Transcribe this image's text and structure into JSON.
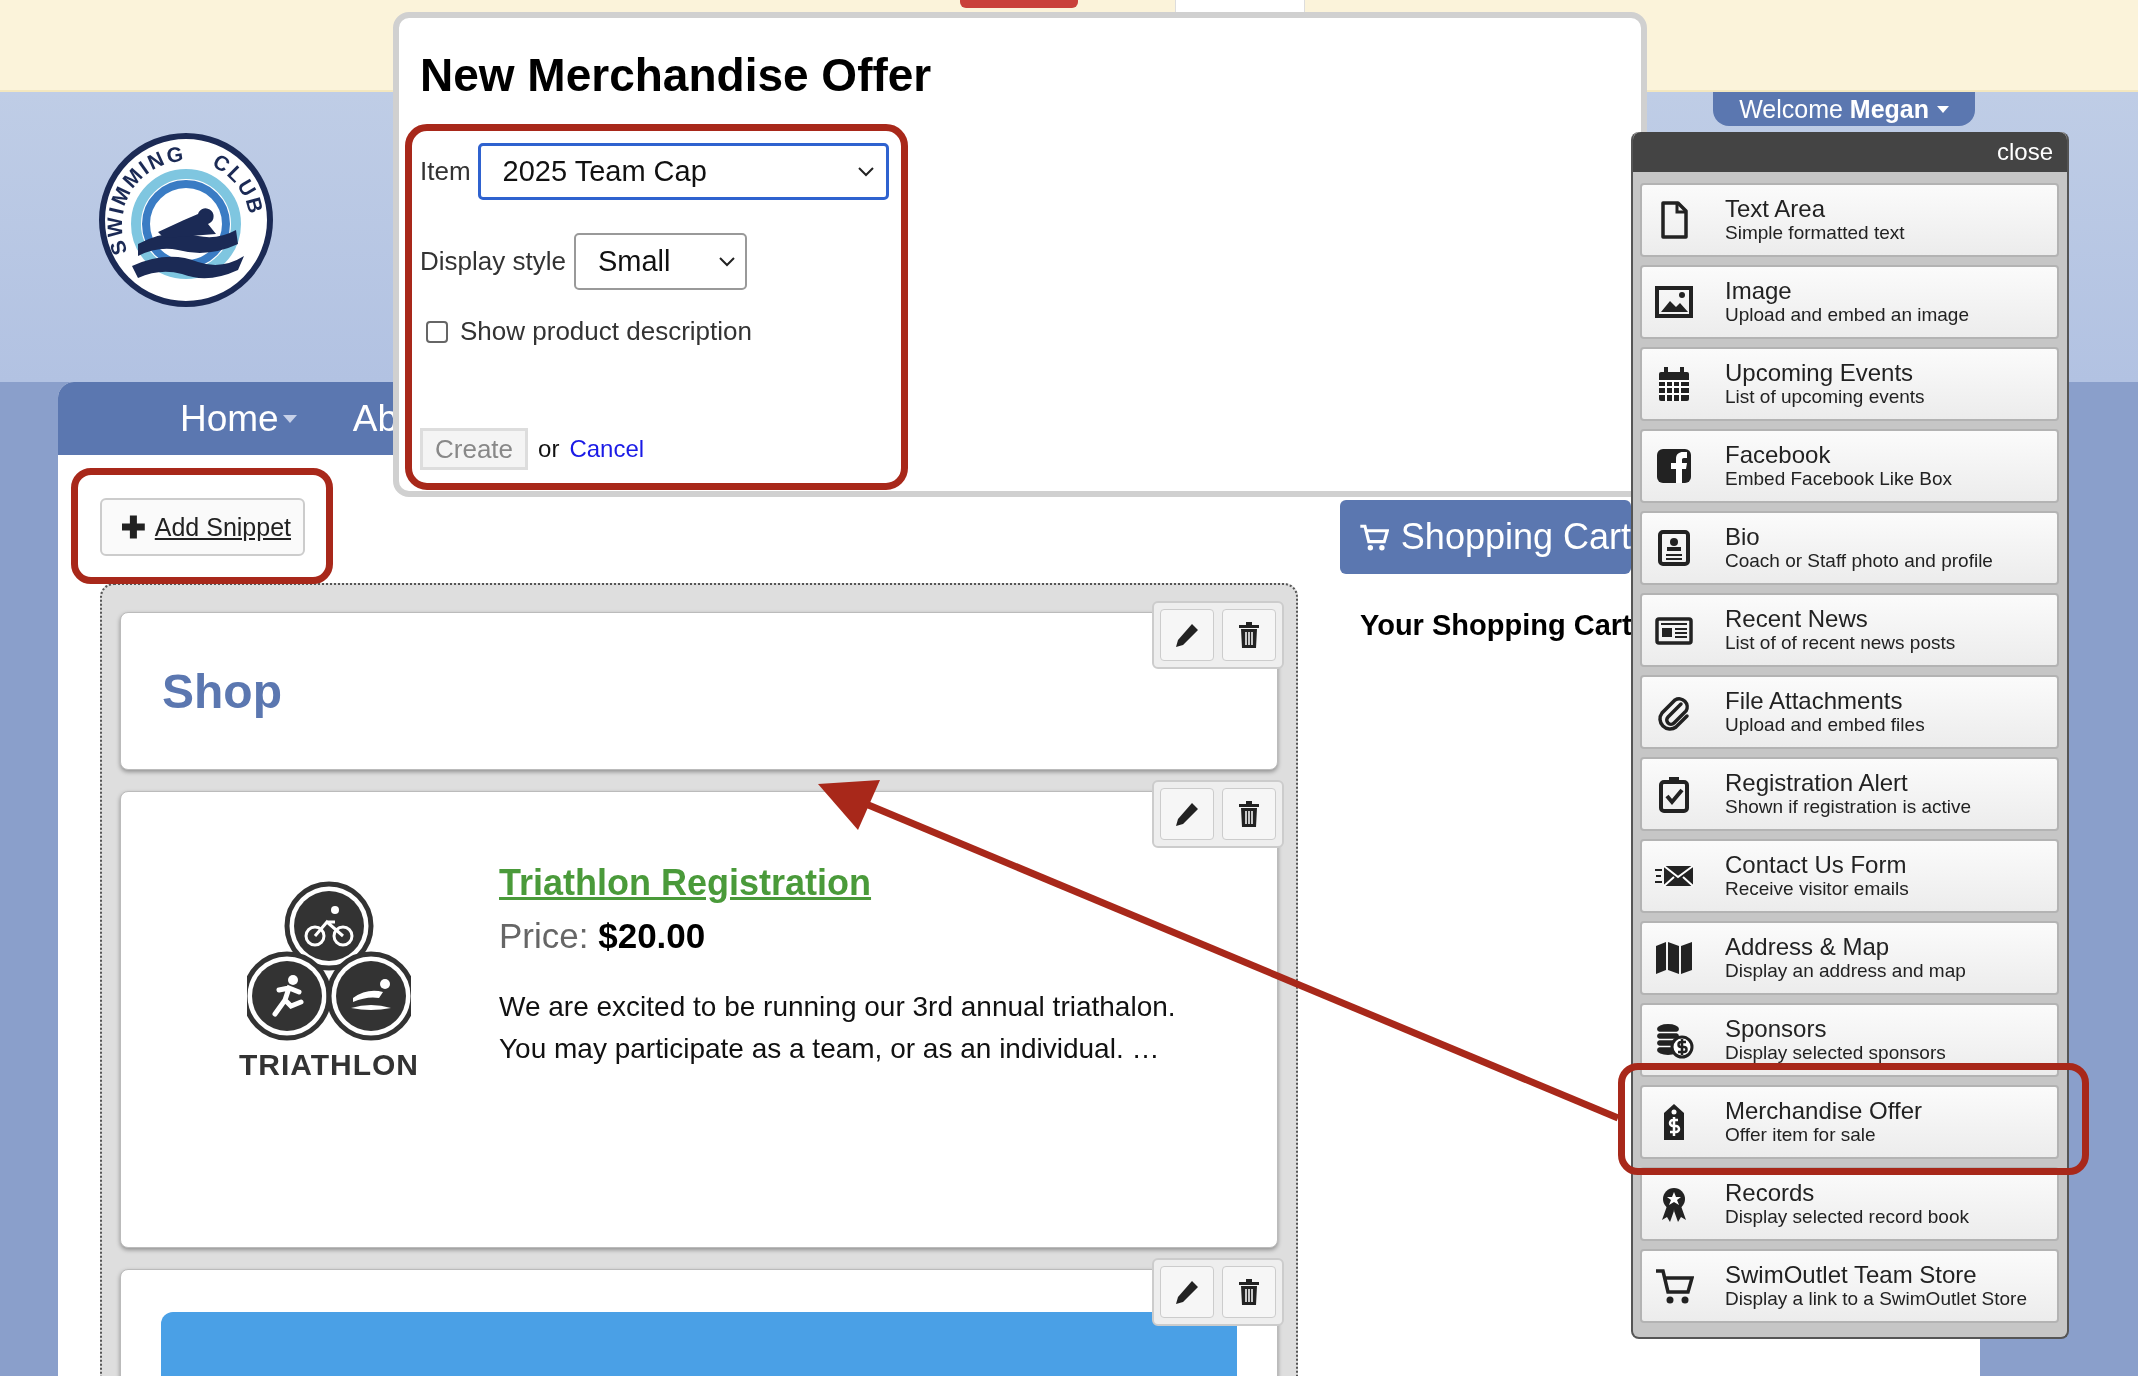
{
  "header": {
    "logo_words": [
      "SWIMMING",
      "CLUB"
    ],
    "welcome": "Welcome **Megan**",
    "nav": [
      {
        "label": "Home",
        "dropdown": true
      },
      {
        "label": "Ab",
        "dropdown": false
      }
    ]
  },
  "toolbar": {
    "add_snippet": "Add Snippet",
    "highlighted": true
  },
  "snippets": [
    {
      "kind": "heading",
      "title": "Shop"
    },
    {
      "kind": "product",
      "title": "Triathlon Registration",
      "logo_caption": "TRIATHLON",
      "price_label": "Price:",
      "price": "$20.00",
      "description_lines": [
        "We are excited to be running our 3rd annual triathalon.",
        "You may participate as a team, or as an individual. …"
      ]
    },
    {
      "kind": "banner"
    }
  ],
  "cart": {
    "tab": "Shopping Cart",
    "heading": "Your Shopping Cart"
  },
  "modal": {
    "title": "New Merchandise Offer",
    "highlighted": true,
    "item_label": "Item",
    "item_value": "2025 Team Cap",
    "style_label": "Display style",
    "style_value": "Small",
    "checkbox": {
      "label": "Show product description",
      "checked": false
    },
    "create": {
      "label": "Create",
      "disabled": true
    },
    "or_text": "or",
    "cancel": "Cancel"
  },
  "snippet_panel": {
    "close": "close",
    "items": [
      {
        "title": "Text Area",
        "subtitle": "Simple formatted text",
        "selected": false
      },
      {
        "title": "Image",
        "subtitle": "Upload and embed an image",
        "selected": false
      },
      {
        "title": "Upcoming Events",
        "subtitle": "List of upcoming events",
        "selected": false
      },
      {
        "title": "Facebook",
        "subtitle": "Embed Facebook Like Box",
        "selected": false
      },
      {
        "title": "Bio",
        "subtitle": "Coach or Staff photo and profile",
        "selected": false
      },
      {
        "title": "Recent News",
        "subtitle": "List of of recent news posts",
        "selected": false
      },
      {
        "title": "File Attachments",
        "subtitle": "Upload and embed files",
        "selected": false
      },
      {
        "title": "Registration Alert",
        "subtitle": "Shown if registration is active",
        "selected": false
      },
      {
        "title": "Contact Us Form",
        "subtitle": "Receive visitor emails",
        "selected": false
      },
      {
        "title": "Address & Map",
        "subtitle": "Display an address and map",
        "selected": false
      },
      {
        "title": "Sponsors",
        "subtitle": "Display selected sponsors",
        "selected": false
      },
      {
        "title": "Merchandise Offer",
        "subtitle": "Offer item for sale",
        "selected": true
      },
      {
        "title": "Records",
        "subtitle": "Display selected record book",
        "selected": false
      },
      {
        "title": "SwimOutlet Team Store",
        "subtitle": "Display a link to a SwimOutlet Store",
        "selected": false
      }
    ]
  }
}
